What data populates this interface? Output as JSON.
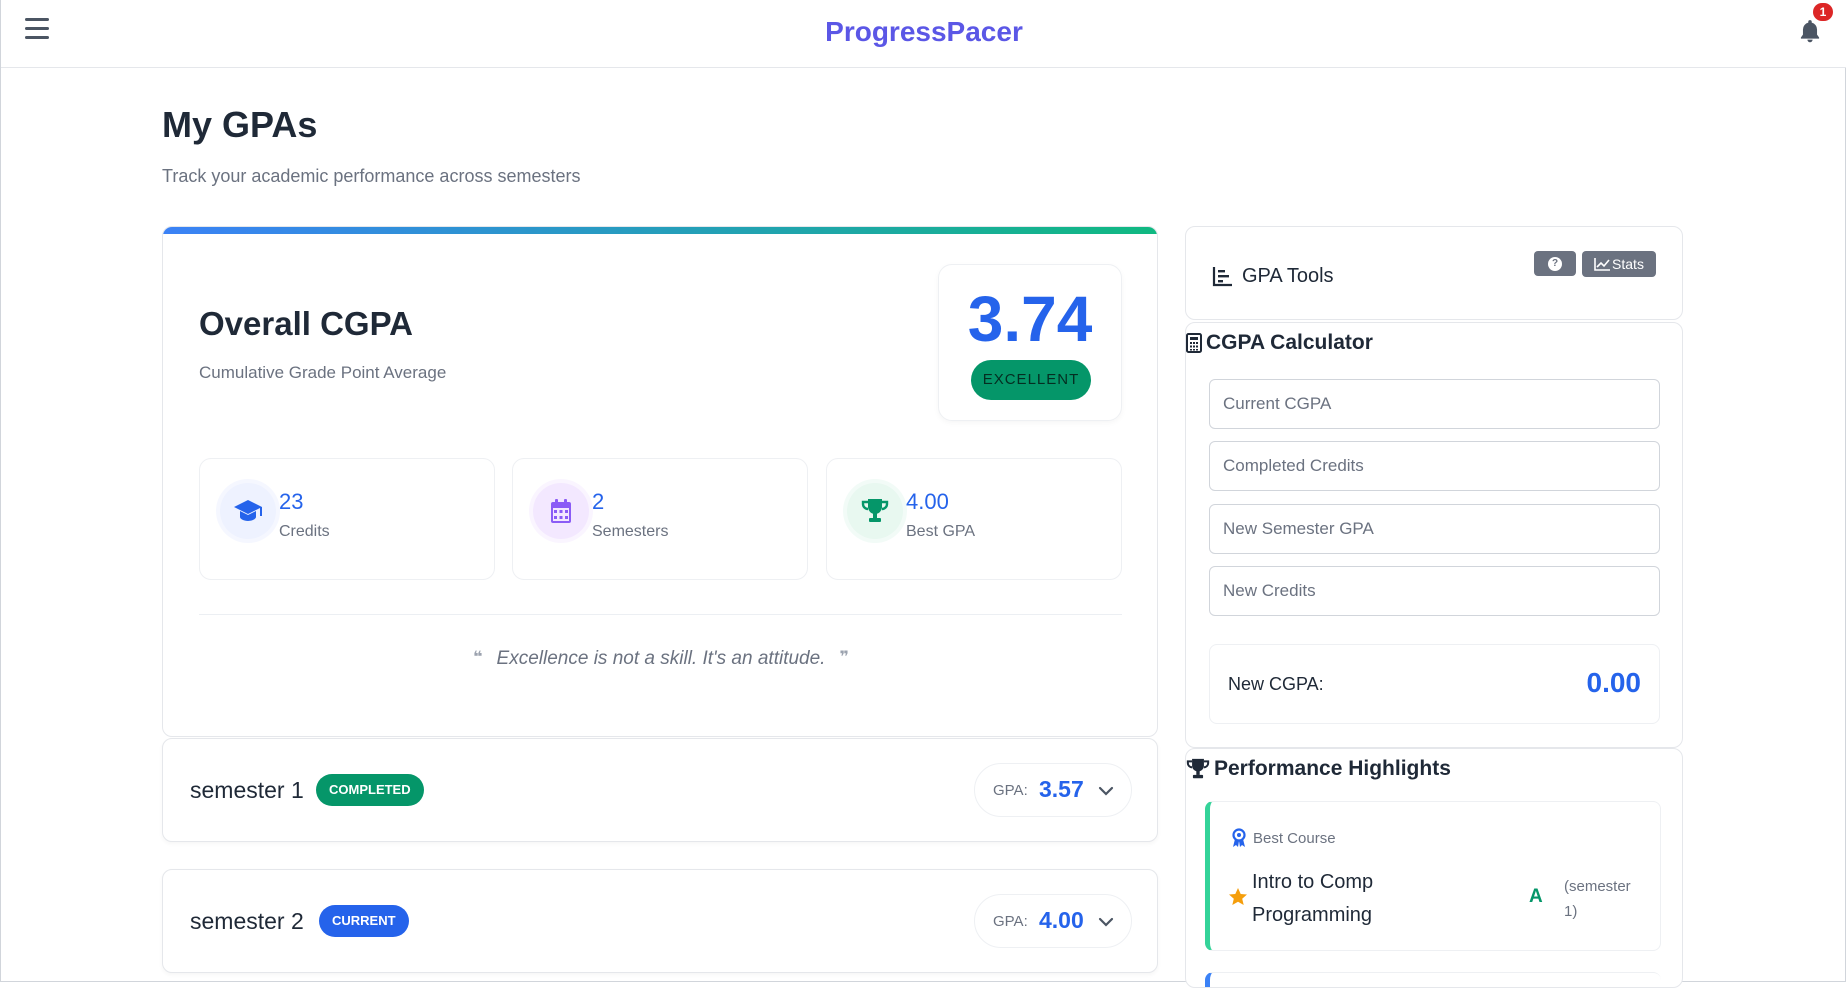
{
  "header": {
    "brand": "ProgressPacer",
    "notification_count": "1"
  },
  "page": {
    "title": "My GPAs",
    "subtitle": "Track your academic performance across semesters"
  },
  "overall": {
    "title": "Overall CGPA",
    "subtitle": "Cumulative Grade Point Average",
    "value": "3.74",
    "rating": "EXCELLENT",
    "stats": [
      {
        "value": "23",
        "label": "Credits",
        "icon": "graduation-cap-icon"
      },
      {
        "value": "2",
        "label": "Semesters",
        "icon": "calendar-icon"
      },
      {
        "value": "4.00",
        "label": "Best GPA",
        "icon": "trophy-icon"
      }
    ],
    "quote": "Excellence is not a skill. It's an attitude."
  },
  "semesters": [
    {
      "name": "semester 1",
      "status": "COMPLETED",
      "status_color": "#059669",
      "gpa_label": "GPA:",
      "gpa": "3.57"
    },
    {
      "name": "semester 2",
      "status": "CURRENT",
      "status_color": "#2563eb",
      "gpa_label": "GPA:",
      "gpa": "4.00"
    }
  ],
  "tools": {
    "title": "GPA Tools",
    "stats_label": "Stats"
  },
  "calculator": {
    "title": "CGPA Calculator",
    "fields": [
      {
        "placeholder": "Current CGPA"
      },
      {
        "placeholder": "Completed Credits"
      },
      {
        "placeholder": "New Semester GPA"
      },
      {
        "placeholder": "New Credits"
      }
    ],
    "result_label": "New CGPA:",
    "result_value": "0.00"
  },
  "highlights": {
    "title": "Performance Highlights",
    "best_course_label": "Best Course",
    "course_name": "Intro to Comp Programming",
    "grade": "A",
    "semester_note": "(semester 1)"
  },
  "colors": {
    "brand": "#5b57e6",
    "accent": "#2563eb",
    "success": "#059669",
    "badge": "#dc2626"
  }
}
